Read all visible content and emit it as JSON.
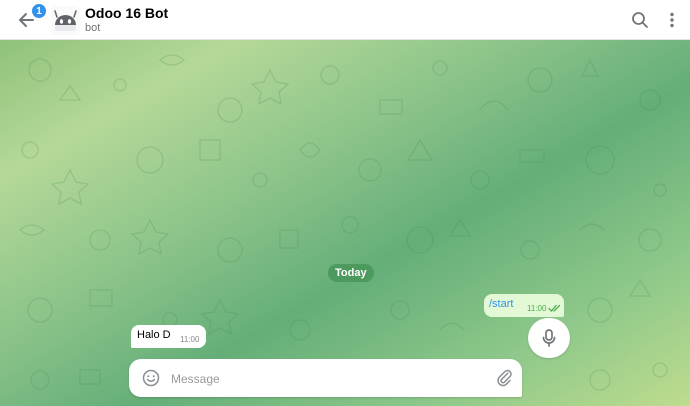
{
  "header": {
    "back_badge": "1",
    "title": "Odoo 16 Bot",
    "subtitle": "bot",
    "icons": [
      "back-arrow-icon",
      "bot-avatar",
      "search-icon",
      "more-vertical-icon"
    ]
  },
  "chat": {
    "date_label": "Today",
    "messages": [
      {
        "direction": "outgoing",
        "text": "/start",
        "time": "11:00",
        "status": "read"
      },
      {
        "direction": "incoming",
        "text": "Halo D",
        "time": "11:00"
      }
    ]
  },
  "composer": {
    "placeholder": "Message",
    "icons": [
      "emoji-icon",
      "attach-icon",
      "microphone-icon"
    ]
  },
  "colors": {
    "accent": "#3390ec",
    "outgoing_bubble": "#e3f8d5",
    "read_check": "#4fae4e",
    "date_pill": "#4c9a5d"
  }
}
